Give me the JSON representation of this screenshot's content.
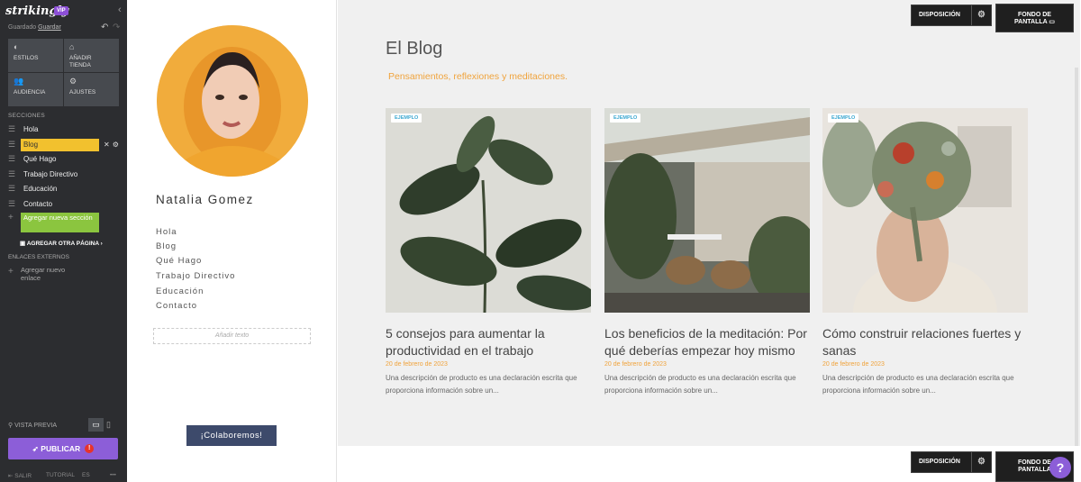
{
  "editor": {
    "logo": "strikingly",
    "vip": "VIP",
    "saved_text": "Guardado",
    "save_link": "Guardar",
    "tools": [
      {
        "icon": "palette-icon",
        "label": "ESTILOS"
      },
      {
        "icon": "store-icon",
        "label": "AÑADIR TIENDA"
      },
      {
        "icon": "users-icon",
        "label": "AUDIENCIA"
      },
      {
        "icon": "gear-icon",
        "label": "AJUSTES"
      }
    ],
    "sections_heading": "SECCIONES",
    "sections": [
      {
        "label": "Hola",
        "selected": false
      },
      {
        "label": "Blog",
        "selected": true
      },
      {
        "label": "Qué Hago",
        "selected": false
      },
      {
        "label": "Trabajo Directivo",
        "selected": false
      },
      {
        "label": "Educación",
        "selected": false
      },
      {
        "label": "Contacto",
        "selected": false
      }
    ],
    "add_section": "Agregar nueva sección",
    "add_page": "AGREGAR OTRA PÁGINA",
    "external_heading": "ENLACES EXTERNOS",
    "add_link": "Agregar nuevo enlace",
    "preview": "VISTA PREVIA",
    "publish": "PUBLICAR",
    "footer": {
      "exit": "SALIR",
      "tutorial": "TUTORIAL",
      "lang": "ES",
      "more": "•••"
    }
  },
  "sidebar": {
    "name": "Natalia Gomez",
    "nav": [
      "Hola",
      "Blog",
      "Qué Hago",
      "Trabajo Directivo",
      "Educación",
      "Contacto"
    ],
    "add_text": "Añadir texto",
    "cta": "¡Colaboremos!"
  },
  "blog": {
    "title": "El Blog",
    "subtitle": "Pensamientos, reflexiones y meditaciones.",
    "posts": [
      {
        "badge": "EJEMPLO",
        "title": "5 consejos para aumentar la productividad en el trabajo",
        "date": "20 de febrero de 2023",
        "desc": "Una descripción de producto es una declaración escrita que proporciona información sobre un..."
      },
      {
        "badge": "EJEMPLO",
        "title": "Los beneficios de la meditación: Por qué deberías empezar hoy mismo",
        "date": "20 de febrero de 2023",
        "desc": "Una descripción de producto es una declaración escrita que proporciona información sobre un..."
      },
      {
        "badge": "EJEMPLO",
        "title": "Cómo construir relaciones fuertes y sanas",
        "date": "20 de febrero de 2023",
        "desc": "Una descripción de producto es una declaración escrita que proporciona información sobre un..."
      }
    ]
  },
  "toolbar": {
    "layout": "DISPOSICIÓN",
    "bg_line1": "FONDO DE",
    "bg_line2": "PANTALLA"
  },
  "help": "?",
  "colors": {
    "accent": "#8c5ed8",
    "highlight": "#f2c12e",
    "add": "#8bc53f",
    "orange": "#f0a33c"
  }
}
